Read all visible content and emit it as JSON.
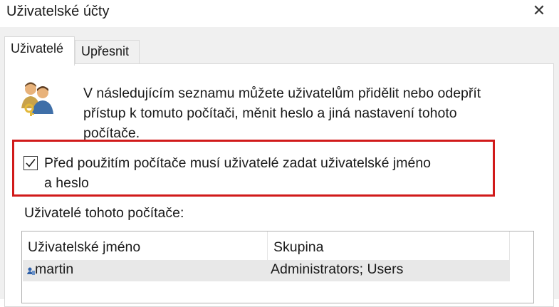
{
  "window": {
    "title": "Uživatelské účty",
    "close_icon": "close-icon",
    "close_glyph": "✕"
  },
  "tabs": [
    {
      "label": "Uživatelé",
      "active": true
    },
    {
      "label": "Upřesnit",
      "active": false
    }
  ],
  "users_panel": {
    "icon": "users-keys-icon",
    "description_lines": [
      "V následujícím seznamu můžete uživatelům přidělit nebo odepřít",
      "přístup k tomuto počítači, měnit heslo a jiná nastavení tohoto",
      "počítače."
    ],
    "require_login": {
      "checked": true,
      "label_lines": [
        "Před použitím počítače musí uživatelé zadat uživatelské jméno",
        "a heslo"
      ]
    },
    "highlight_color": "#d11a1a",
    "users_list_label": "Uživatelé tohoto počítače:",
    "users_table": {
      "columns": [
        "Uživatelské jméno",
        "Skupina"
      ],
      "rows": [
        {
          "name": "martin",
          "group": "Administrators; Users",
          "selected": true,
          "icon": "user-icon"
        }
      ]
    }
  }
}
